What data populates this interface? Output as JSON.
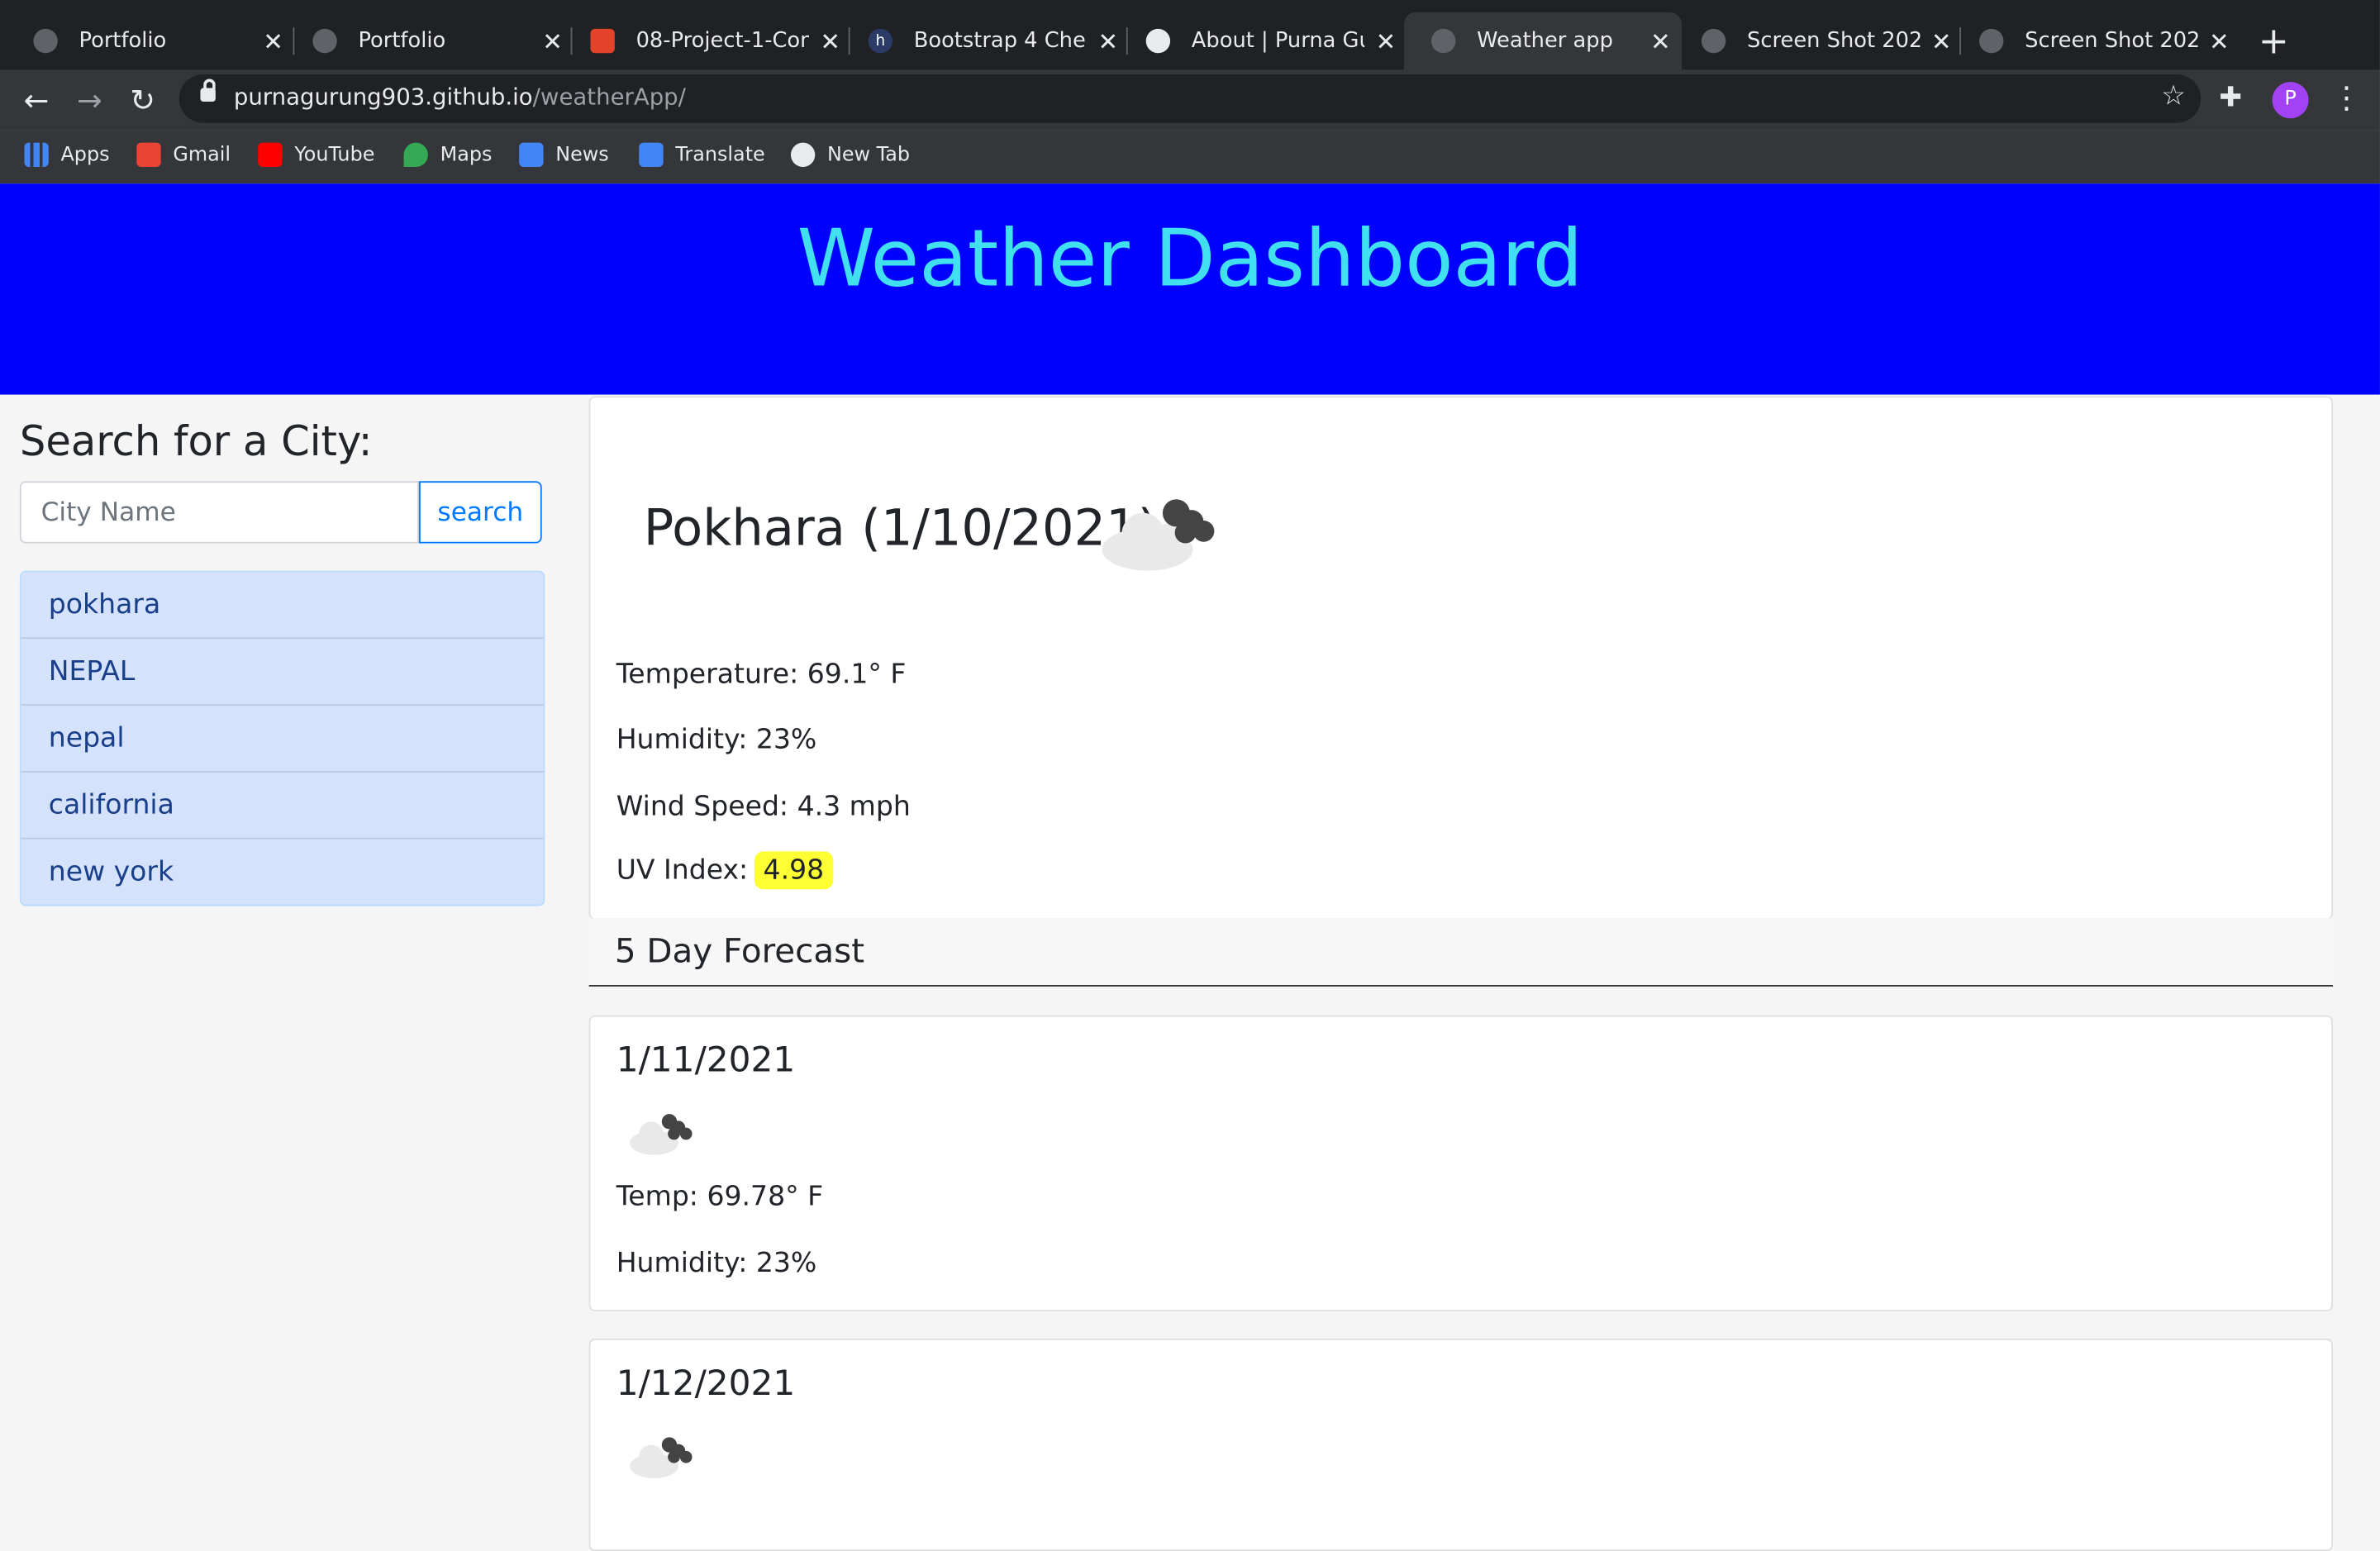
{
  "browser": {
    "tabs": [
      {
        "title": "Portfolio"
      },
      {
        "title": "Portfolio"
      },
      {
        "title": "08-Project-1-Cont"
      },
      {
        "title": "Bootstrap 4 Cheat"
      },
      {
        "title": "About | Purna Guru"
      },
      {
        "title": "Weather app"
      },
      {
        "title": "Screen Shot 2021-"
      },
      {
        "title": "Screen Shot 2021-"
      }
    ],
    "url_host": "purnagurung903.github.io",
    "url_path": "/weatherApp/",
    "profile_initial": "P",
    "bookmarks": [
      "Apps",
      "Gmail",
      "YouTube",
      "Maps",
      "News",
      "Translate",
      "New Tab"
    ]
  },
  "header": {
    "title": "Weather Dashboard"
  },
  "sidebar": {
    "title": "Search for a City:",
    "input_placeholder": "City Name",
    "search_label": "search",
    "history": [
      "pokhara",
      "NEPAL",
      "nepal",
      "california",
      "new york"
    ]
  },
  "current": {
    "title": "Pokhara (1/10/2021)",
    "icon": "cloud-icon",
    "temperature": "Temperature: 69.1° F",
    "humidity": "Humidity: 23%",
    "wind": "Wind Speed: 4.3 mph",
    "uv_label": "UV Index:",
    "uv_value": "4.98",
    "uv_color": "#ffff33"
  },
  "forecast": {
    "title": "5 Day Forecast",
    "days": [
      {
        "date": "1/11/2021",
        "icon": "cloud-icon",
        "temp": "Temp: 69.78° F",
        "humidity": "Humidity: 23%"
      },
      {
        "date": "1/12/2021",
        "icon": "cloud-icon"
      }
    ]
  },
  "colors": {
    "header_bg": "#0000ff",
    "header_text": "#40e0f0",
    "accent": "#007bff"
  }
}
